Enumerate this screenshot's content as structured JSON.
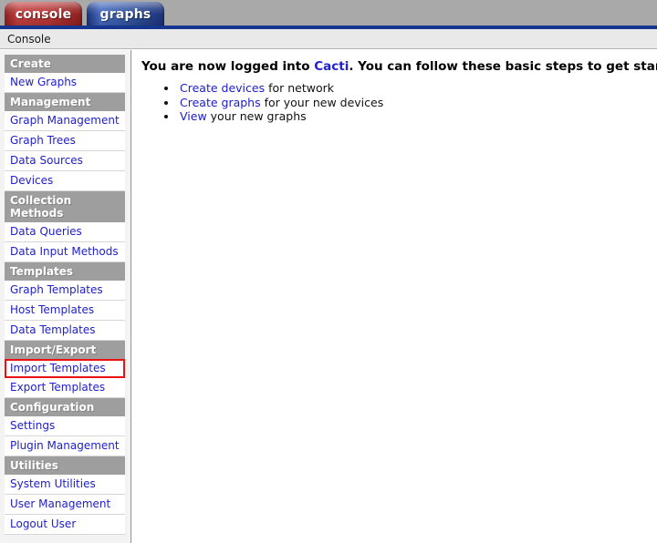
{
  "tabs": [
    {
      "id": "console",
      "label": "console",
      "active": true,
      "color": "#b93636"
    },
    {
      "id": "graphs",
      "label": "graphs",
      "active": false,
      "color": "#32549f"
    }
  ],
  "breadcrumb": {
    "text": "Console"
  },
  "sidebar": {
    "sections": [
      {
        "header": "Create",
        "items": [
          {
            "label": "New Graphs",
            "highlighted": false
          }
        ]
      },
      {
        "header": "Management",
        "items": [
          {
            "label": "Graph Management",
            "highlighted": false
          },
          {
            "label": "Graph Trees",
            "highlighted": false
          },
          {
            "label": "Data Sources",
            "highlighted": false
          },
          {
            "label": "Devices",
            "highlighted": false
          }
        ]
      },
      {
        "header": "Collection Methods",
        "items": [
          {
            "label": "Data Queries",
            "highlighted": false
          },
          {
            "label": "Data Input Methods",
            "highlighted": false
          }
        ]
      },
      {
        "header": "Templates",
        "items": [
          {
            "label": "Graph Templates",
            "highlighted": false
          },
          {
            "label": "Host Templates",
            "highlighted": false
          },
          {
            "label": "Data Templates",
            "highlighted": false
          }
        ]
      },
      {
        "header": "Import/Export",
        "items": [
          {
            "label": "Import Templates",
            "highlighted": true
          },
          {
            "label": "Export Templates",
            "highlighted": false
          }
        ]
      },
      {
        "header": "Configuration",
        "items": [
          {
            "label": "Settings",
            "highlighted": false
          },
          {
            "label": "Plugin Management",
            "highlighted": false
          }
        ]
      },
      {
        "header": "Utilities",
        "items": [
          {
            "label": "System Utilities",
            "highlighted": false
          },
          {
            "label": "User Management",
            "highlighted": false
          },
          {
            "label": "Logout User",
            "highlighted": false
          }
        ]
      }
    ]
  },
  "main": {
    "heading": {
      "before": "You are now logged into ",
      "link": "Cacti",
      "after": ". You can follow these basic steps to get started."
    },
    "steps": [
      {
        "link": "Create devices",
        "rest": " for network"
      },
      {
        "link": "Create graphs",
        "rest": " for your new devices"
      },
      {
        "link": "View",
        "rest": " your new graphs"
      }
    ]
  },
  "colors": {
    "link": "#2020cc",
    "highlight_box": "#ee1111",
    "header_band": "#a9a9a9",
    "blue_rule": "#15368f",
    "section_header_bg": "#9e9e9e"
  }
}
